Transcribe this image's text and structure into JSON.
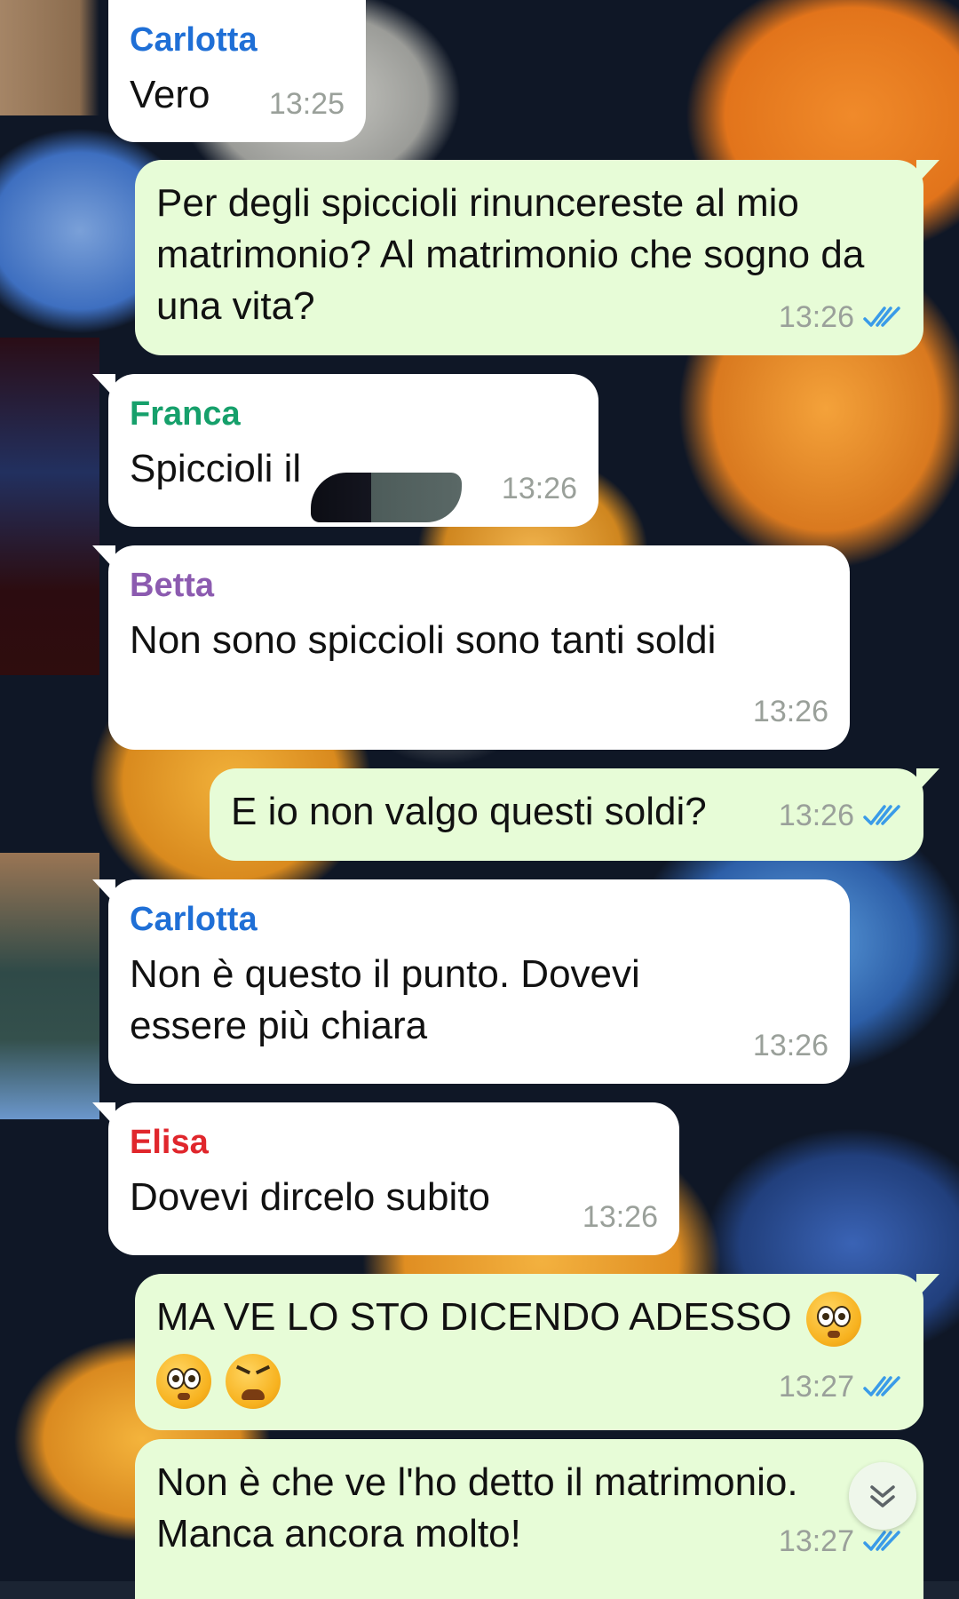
{
  "colors": {
    "incoming_bubble": "#ffffff",
    "outgoing_bubble": "#e7fcd7",
    "timestamp": "#9aa09a",
    "read_ticks": "#3a9be8"
  },
  "messages": [
    {
      "direction": "in",
      "sender": "Carlotta",
      "sender_color": "#1f6fd6",
      "text": "Vero",
      "time": "13:25"
    },
    {
      "direction": "out",
      "text": "Per degli spiccioli rinuncereste al mio matrimonio? Al matrimonio che sogno da una vita?",
      "time": "13:26",
      "status_icon": "double-check-icon"
    },
    {
      "direction": "in",
      "sender": "Franca",
      "sender_color": "#16a06b",
      "text": "Spiccioli il",
      "time": "13:26"
    },
    {
      "direction": "in",
      "sender": "Betta",
      "sender_color": "#8c5bb0",
      "text": "Non sono spiccioli sono tanti soldi",
      "time": "13:26"
    },
    {
      "direction": "out",
      "text": "E io non valgo questi soldi?",
      "time": "13:26",
      "status_icon": "double-check-icon"
    },
    {
      "direction": "in",
      "sender": "Carlotta",
      "sender_color": "#1f6fd6",
      "text": "Non è questo il punto. Dovevi essere più chiara",
      "time": "13:26"
    },
    {
      "direction": "in",
      "sender": "Elisa",
      "sender_color": "#e0262c",
      "text": "Dovevi dircelo subito",
      "time": "13:26"
    },
    {
      "direction": "out",
      "text": "MA VE LO STO DICENDO ADESSO",
      "emojis": [
        "flushed-face-emoji",
        "flushed-face-emoji",
        "tired-face-emoji"
      ],
      "time": "13:27",
      "status_icon": "double-check-icon"
    },
    {
      "direction": "out",
      "text": "Non è che ve l'ho detto il matrimonio. Manca ancora molto!",
      "time": "13:27",
      "status_icon": "double-check-icon"
    }
  ],
  "scroll_button_icon": "chevron-double-down-icon"
}
